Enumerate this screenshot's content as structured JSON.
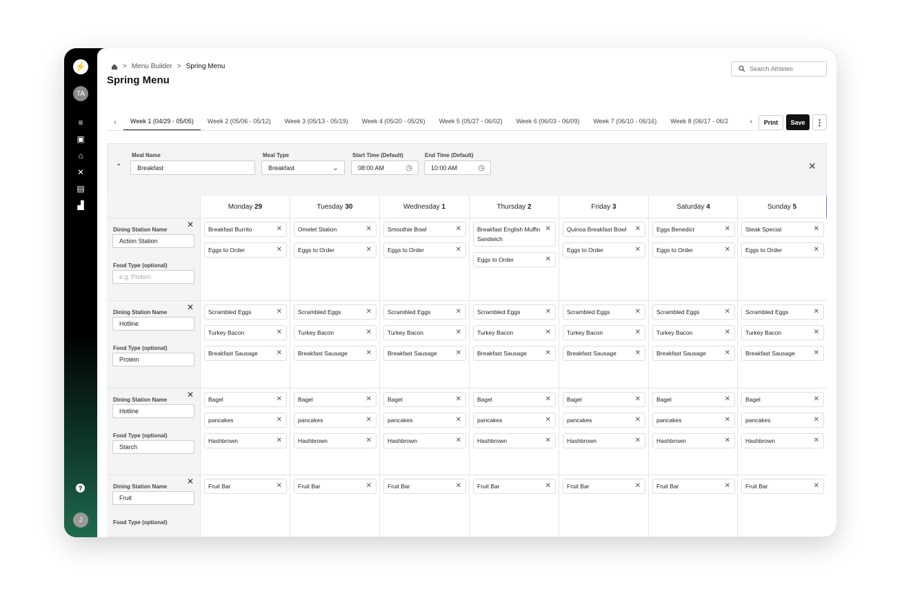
{
  "sidebar": {
    "avatar": "TA",
    "user_initial": "J",
    "help": "?"
  },
  "breadcrumb": {
    "parent": "Menu Builder",
    "current": "Spring Menu",
    "separator": ">"
  },
  "title": "Spring Menu",
  "search": {
    "placeholder": "Search Athletes"
  },
  "tabs": [
    "Week 1 (04/29 - 05/05)",
    "Week 2 (05/06 - 05/12)",
    "Week 3 (05/13 - 05/19)",
    "Week 4 (05/20 - 05/26)",
    "Week 5 (05/27 - 06/02)",
    "Week 6 (06/03 - 06/09)",
    "Week 7 (06/10 - 06/16)",
    "Week 8 (06/17 - 06/2"
  ],
  "actions": {
    "print": "Print",
    "save": "Save"
  },
  "meal": {
    "name_label": "Meal Name",
    "name": "Breakfast",
    "type_label": "Meal Type",
    "type": "Breakfast",
    "start_label": "Start Time (Default)",
    "start": "08:00 AM",
    "end_label": "End Time (Default)",
    "end": "10:00 AM"
  },
  "days": [
    {
      "name": "Monday",
      "num": "29"
    },
    {
      "name": "Tuesday",
      "num": "30"
    },
    {
      "name": "Wednesday",
      "num": "1"
    },
    {
      "name": "Thursday",
      "num": "2"
    },
    {
      "name": "Friday",
      "num": "3"
    },
    {
      "name": "Saturday",
      "num": "4"
    },
    {
      "name": "Sunday",
      "num": "5"
    }
  ],
  "station_label": "Dining Station Name",
  "food_type_label": "Food Type (optional)",
  "food_type_placeholder": "e.g. Protein",
  "stations": [
    {
      "name": "Action Station",
      "food_type": "",
      "items": [
        [
          "Breakfast Burrito",
          "Eggs to Order"
        ],
        [
          "Omelet Station",
          "Eggs to Order"
        ],
        [
          "Smoothie Bowl",
          "Eggs to Order"
        ],
        [
          "Breakfast English Muffin Sandwich",
          "Eggs to Order"
        ],
        [
          "Quinoa Breakfast Bowl",
          "Eggs to Order"
        ],
        [
          "Eggs Benedict",
          "Eggs to Order"
        ],
        [
          "Steak Special",
          "Eggs to Order"
        ]
      ]
    },
    {
      "name": "Hotline",
      "food_type": "Protein",
      "items": [
        [
          "Scrambled Eggs",
          "Turkey Bacon",
          "Breakfast Sausage"
        ],
        [
          "Scrambled Eggs",
          "Turkey Bacon",
          "Breakfast Sausage"
        ],
        [
          "Scrambled Eggs",
          "Turkey Bacon",
          "Breakfast Sausage"
        ],
        [
          "Scrambled Eggs",
          "Turkey Bacon",
          "Breakfast Sausage"
        ],
        [
          "Scrambled Eggs",
          "Turkey Bacon",
          "Breakfast Sausage"
        ],
        [
          "Scrambled Eggs",
          "Turkey Bacon",
          "Breakfast Sausage"
        ],
        [
          "Scrambled Eggs",
          "Turkey Bacon",
          "Breakfast Sausage"
        ]
      ]
    },
    {
      "name": "Hotline",
      "food_type": "Starch",
      "items": [
        [
          "Bagel",
          "pancakes",
          "Hashbrown"
        ],
        [
          "Bagel",
          "pancakes",
          "Hashbrown"
        ],
        [
          "Bagel",
          "pancakes",
          "Hashbrown"
        ],
        [
          "Bagel",
          "pancakes",
          "Hashbrown"
        ],
        [
          "Bagel",
          "pancakes",
          "Hashbrown"
        ],
        [
          "Bagel",
          "pancakes",
          "Hashbrown"
        ],
        [
          "Bagel",
          "pancakes",
          "Hashbrown"
        ]
      ]
    },
    {
      "name": "Fruit",
      "food_type": "",
      "items": [
        [
          "Fruit Bar"
        ],
        [
          "Fruit Bar"
        ],
        [
          "Fruit Bar"
        ],
        [
          "Fruit Bar"
        ],
        [
          "Fruit Bar"
        ],
        [
          "Fruit Bar"
        ],
        [
          "Fruit Bar"
        ]
      ]
    }
  ]
}
